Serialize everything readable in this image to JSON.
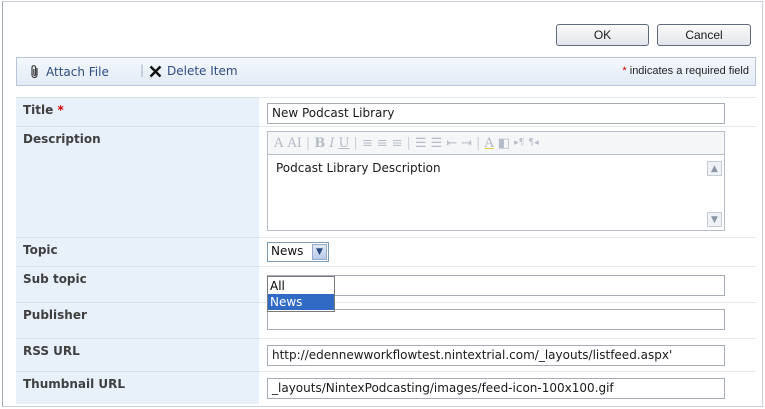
{
  "buttons": {
    "ok": "OK",
    "cancel": "Cancel"
  },
  "toolbar": {
    "attach_label": "Attach File",
    "separator": "|",
    "delete_label": "Delete Item",
    "required_star": "*",
    "required_note": "indicates a required field"
  },
  "fields": {
    "title": {
      "label": "Title",
      "required": "*",
      "value": "New Podcast Library"
    },
    "description": {
      "label": "Description",
      "value": "Podcast Library Description",
      "toolbar_glyphs": [
        "A",
        "AI",
        "|",
        "B",
        "I",
        "U",
        "|",
        "≡",
        "≡",
        "≡",
        "|",
        "☰",
        "☰",
        "⇤",
        "⇥",
        "|",
        "A",
        "◧",
        "▸¶",
        "¶◂"
      ]
    },
    "topic": {
      "label": "Topic",
      "selected": "News",
      "options": [
        "All",
        "News"
      ]
    },
    "subtopic": {
      "label": "Sub topic",
      "value": ""
    },
    "publisher": {
      "label": "Publisher",
      "value": ""
    },
    "rss_url": {
      "label": "RSS URL",
      "value": "http://edennewworkflowtest.nintextrial.com/_layouts/listfeed.aspx'"
    },
    "thumbnail_url": {
      "label": "Thumbnail URL",
      "value": "_layouts/NintexPodcasting/images/feed-icon-100x100.gif"
    }
  },
  "icons": {
    "attach": "paperclip-icon",
    "delete": "x-delete-icon",
    "dropdown": "chevron-down-icon"
  },
  "colors": {
    "label_bg": "#e8f0fa",
    "toolbar_text": "#2f4d80",
    "required": "#d40000",
    "selected_option": "#316ac5"
  }
}
